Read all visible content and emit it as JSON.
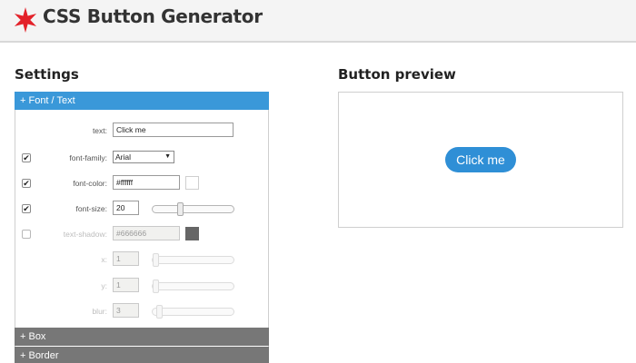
{
  "app": {
    "title": "CSS Button Generator",
    "logo_icon": "red-star-icon",
    "logo_color": "#e3222a"
  },
  "settings": {
    "title": "Settings",
    "sections": [
      {
        "label": "+ Font / Text",
        "expanded": true,
        "color": "#3a98d9"
      },
      {
        "label": "+ Box",
        "expanded": false,
        "color": "#777777"
      },
      {
        "label": "+ Border",
        "expanded": false,
        "color": "#777777"
      }
    ],
    "font": {
      "text": {
        "label": "text:",
        "value": "Click me"
      },
      "family": {
        "label": "font-family:",
        "value": "Arial",
        "checked": true
      },
      "color": {
        "label": "font-color:",
        "value": "#ffffff",
        "checked": true
      },
      "size": {
        "label": "font-size:",
        "value": "20",
        "checked": true
      },
      "shadow": {
        "label": "text-shadow:",
        "value": "#666666",
        "checked": false
      },
      "shadow_x": {
        "label": "x:",
        "value": "1"
      },
      "shadow_y": {
        "label": "y:",
        "value": "1"
      },
      "shadow_blur": {
        "label": "blur:",
        "value": "3"
      }
    }
  },
  "preview": {
    "title": "Button preview",
    "button_label": "Click me",
    "button_color": "#2f8fd6"
  }
}
